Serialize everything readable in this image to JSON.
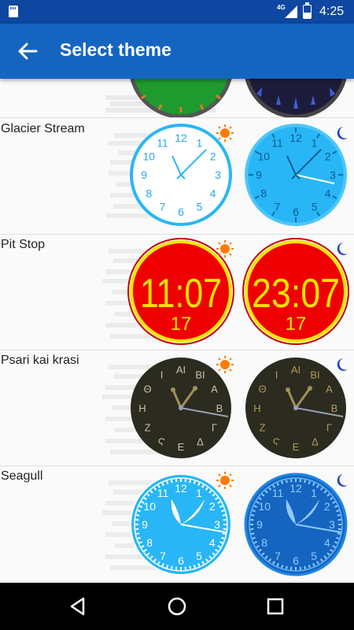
{
  "status": {
    "network": "4G",
    "time": "4:25"
  },
  "toolbar": {
    "title": "Select theme"
  },
  "themes": [
    {
      "name": ""
    },
    {
      "name": "Glacier Stream"
    },
    {
      "name": "Pit Stop",
      "day_time": "11:07",
      "night_time": "23:07",
      "date": "17"
    },
    {
      "name": "Psari kai krasi",
      "numerals": [
        "ΑΙ",
        "ΒΙ",
        "Α",
        "Β",
        "Γ",
        "Δ",
        "Ε",
        "Ϛ",
        "Ζ",
        "Η",
        "Θ",
        "Ι"
      ]
    },
    {
      "name": "Seagull"
    }
  ],
  "clock_numbers": [
    "12",
    "1",
    "2",
    "3",
    "4",
    "5",
    "6",
    "7",
    "8",
    "9",
    "10",
    "11"
  ],
  "icons": {
    "day": "sun-icon",
    "night": "moon-icon",
    "back": "arrow-back-icon"
  },
  "colors": {
    "status_bar": "#0d47a1",
    "app_bar": "#1565c0",
    "sun": "#ff7a00",
    "moon": "#1e3fd0"
  }
}
